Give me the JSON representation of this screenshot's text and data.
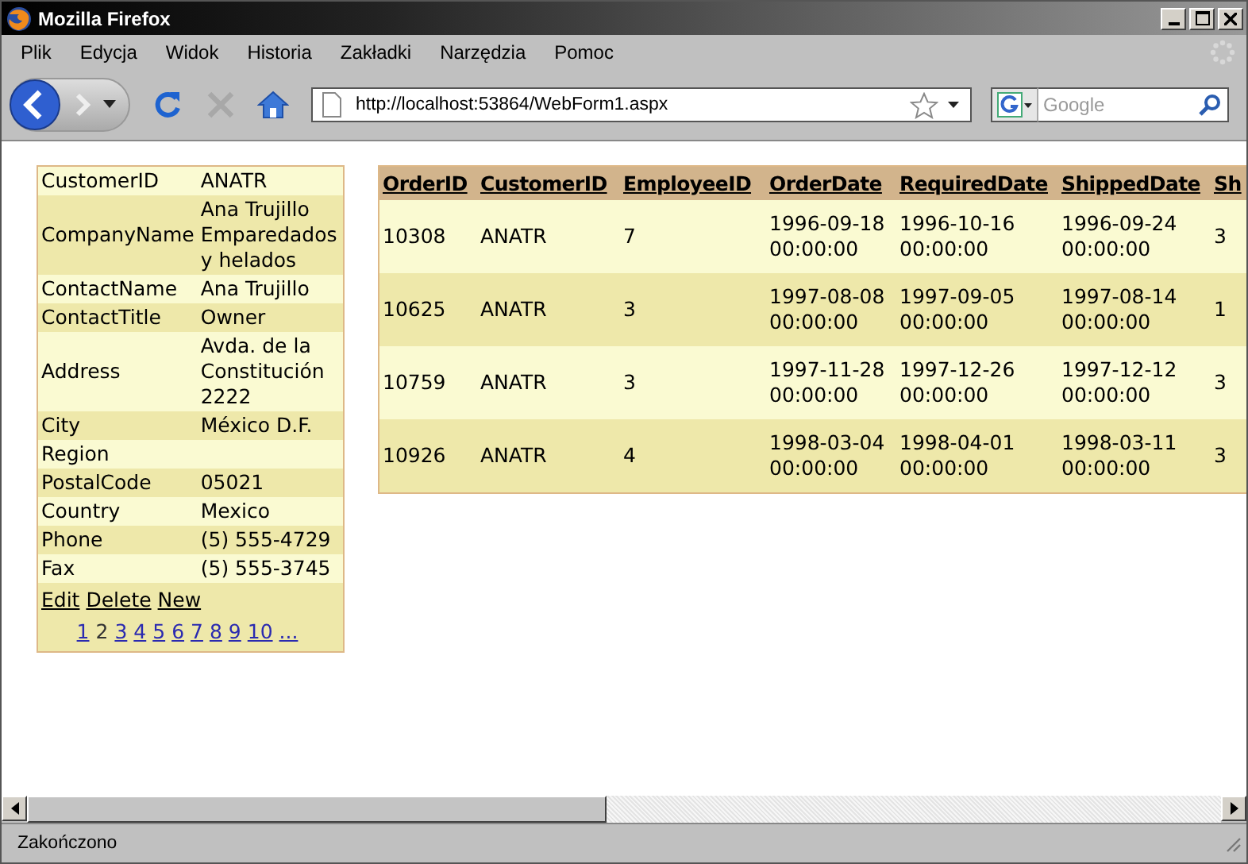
{
  "window": {
    "title": "Mozilla Firefox"
  },
  "menu": [
    "Plik",
    "Edycja",
    "Widok",
    "Historia",
    "Zakładki",
    "Narzędzia",
    "Pomoc"
  ],
  "address_bar": {
    "url": "http://localhost:53864/WebForm1.aspx"
  },
  "search": {
    "placeholder": "Google"
  },
  "details": {
    "fields": [
      {
        "label": "CustomerID",
        "value": "ANATR"
      },
      {
        "label": "CompanyName",
        "value": "Ana Trujillo Emparedados y helados"
      },
      {
        "label": "ContactName",
        "value": "Ana Trujillo"
      },
      {
        "label": "ContactTitle",
        "value": "Owner"
      },
      {
        "label": "Address",
        "value": "Avda. de la Constitución 2222"
      },
      {
        "label": "City",
        "value": "México D.F."
      },
      {
        "label": "Region"
      },
      {
        "label": "PostalCode",
        "value": "05021"
      },
      {
        "label": "Country",
        "value": "Mexico"
      },
      {
        "label": "Phone",
        "value": "(5) 555-4729"
      },
      {
        "label": "Fax",
        "value": "(5) 555-3745"
      }
    ],
    "actions": [
      "Edit",
      "Delete",
      "New"
    ],
    "pages": [
      {
        "label": "1",
        "selected": false
      },
      {
        "label": "2",
        "selected": true
      },
      {
        "label": "3",
        "selected": false
      },
      {
        "label": "4",
        "selected": false
      },
      {
        "label": "5",
        "selected": false
      },
      {
        "label": "6",
        "selected": false
      },
      {
        "label": "7",
        "selected": false
      },
      {
        "label": "8",
        "selected": false
      },
      {
        "label": "9",
        "selected": false
      },
      {
        "label": "10",
        "selected": false
      },
      {
        "label": "...",
        "selected": false
      }
    ]
  },
  "grid": {
    "columns": [
      "OrderID",
      "CustomerID",
      "EmployeeID",
      "OrderDate",
      "RequiredDate",
      "ShippedDate",
      "Sh"
    ],
    "rows": [
      [
        "10308",
        "ANATR",
        "7",
        "1996-09-18 00:00:00",
        "1996-10-16 00:00:00",
        "1996-09-24 00:00:00",
        "3"
      ],
      [
        "10625",
        "ANATR",
        "3",
        "1997-08-08 00:00:00",
        "1997-09-05 00:00:00",
        "1997-08-14 00:00:00",
        "1"
      ],
      [
        "10759",
        "ANATR",
        "3",
        "1997-11-28 00:00:00",
        "1997-12-26 00:00:00",
        "1997-12-12 00:00:00",
        "3"
      ],
      [
        "10926",
        "ANATR",
        "4",
        "1998-03-04 00:00:00",
        "1998-04-01 00:00:00",
        "1998-03-11 00:00:00",
        "3"
      ]
    ]
  },
  "status_bar": "Zakończono"
}
